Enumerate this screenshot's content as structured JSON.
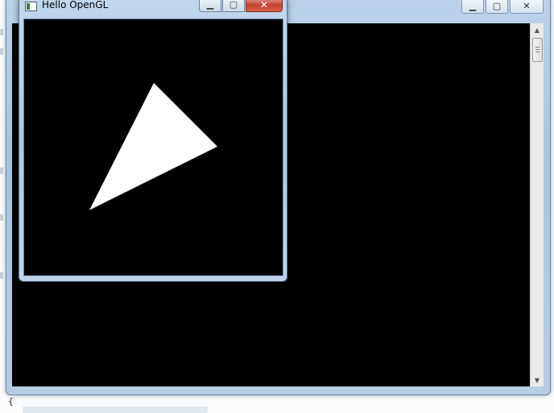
{
  "background_ide": {
    "code_brace": "{"
  },
  "console_window": {
    "minimize_glyph": "▁",
    "maximize_glyph": "▢",
    "close_glyph": "✕",
    "scroll_up_glyph": "▲",
    "scroll_down_glyph": "▼"
  },
  "gl_window": {
    "title": "Hello OpenGL",
    "minimize_glyph": "▁",
    "maximize_glyph": "▢",
    "close_glyph": "✕",
    "canvas_background": "#000000",
    "triangle_color": "#ffffff"
  },
  "colors": {
    "aero_frame": "#b3cbe4",
    "close_red": "#c64130"
  }
}
